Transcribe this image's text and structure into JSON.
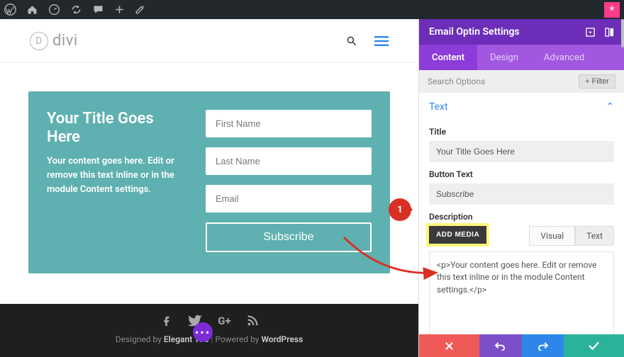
{
  "wp_bar": {
    "star": "*"
  },
  "site": {
    "logo_letter": "D",
    "logo_text": "divi"
  },
  "optin": {
    "title": "Your Title Goes Here",
    "description": "Your content goes here. Edit or remove this text inline or in the module Content settings.",
    "fields": {
      "first_name": "First Name",
      "last_name": "Last Name",
      "email": "Email"
    },
    "button": "Subscribe"
  },
  "footer": {
    "designed_by_prefix": "Designed by ",
    "designed_by": "Elegant The",
    "powered_by_prefix": " Powered by ",
    "powered_by": "WordPress"
  },
  "panel": {
    "title": "Email Optin Settings",
    "tabs": [
      "Content",
      "Design",
      "Advanced"
    ],
    "search_placeholder": "Search Options",
    "filter": "+  Filter",
    "section": "Text",
    "fields": {
      "title_label": "Title",
      "title_value": "Your Title Goes Here",
      "button_label": "Button Text",
      "button_value": "Subscribe",
      "description_label": "Description",
      "add_media": "ADD MEDIA",
      "visual_tab": "Visual",
      "text_tab": "Text",
      "editor_value": "<p>Your content goes here. Edit or remove this text inline or in the module Content settings.</p>"
    }
  },
  "callout": {
    "num": "1"
  }
}
